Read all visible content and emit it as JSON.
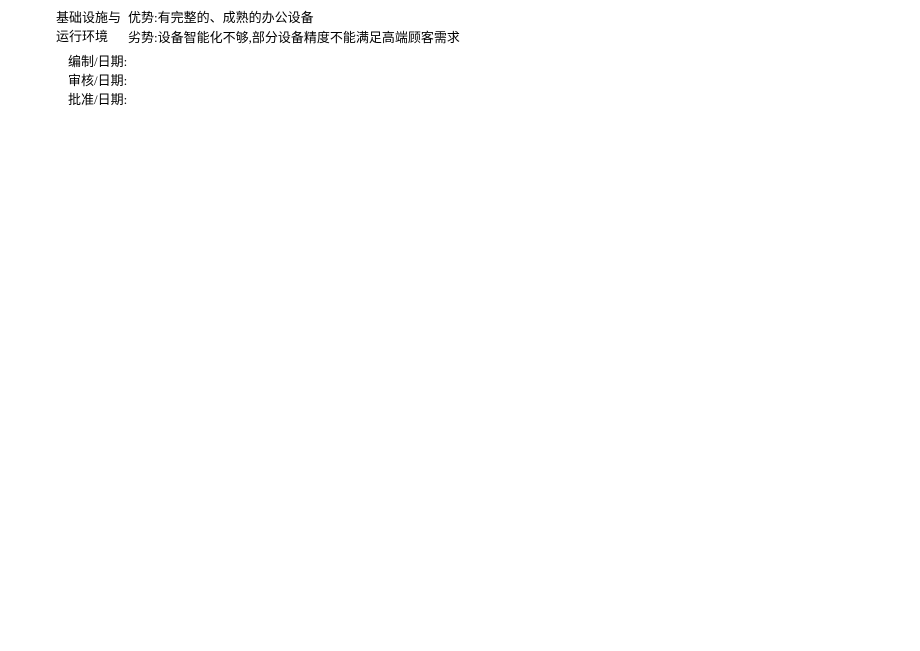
{
  "section": {
    "category_line1": "基础设施与",
    "category_line2": "运行环境",
    "advantage": "优势:有完整的、成熟的办公设备",
    "disadvantage": "劣势:设备智能化不够,部分设备精度不能满足高端顾客需求"
  },
  "signatures": {
    "prepared": "编制/日期:",
    "reviewed": "审核/日期:",
    "approved": "批准/日期:"
  }
}
